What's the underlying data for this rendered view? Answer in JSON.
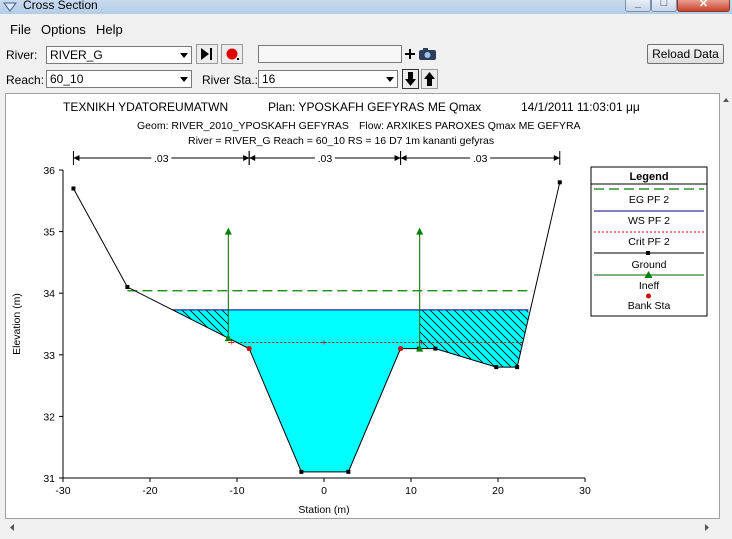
{
  "window": {
    "title": "Cross Section"
  },
  "menu": [
    "File",
    "Options",
    "Help"
  ],
  "toolbar": {
    "river_label": "River:",
    "river_value": "RIVER_G",
    "reach_label": "Reach:",
    "reach_value": "60_10",
    "river_sta_label": "River Sta.:",
    "river_sta_value": "16",
    "search_value": "",
    "reload_label": "Reload Data"
  },
  "plot_header": {
    "line1_left": "TEXNIKH YDATOREUMATWN",
    "line1_plan": "Plan: YPOSKAFH GEFYRAS ME Qmax",
    "line1_date": "14/1/2011   11:03:01 μμ",
    "line2_geom": "Geom: RIVER_2010_YPOSKAFH GEFYRAS",
    "line2_flow": "Flow: ARXIKES PAROXES Qmax ME GEFYRA",
    "line3": "River = RIVER_G   Reach = 60_10      RS = 16    D7 1m kananti gefyras"
  },
  "legend": {
    "title": "Legend",
    "items": [
      "EG PF 2",
      "WS PF 2",
      "Crit PF 2",
      "Ground",
      "Ineff",
      "Bank Sta"
    ]
  },
  "colors": {
    "eg": "#008000",
    "ws": "#000080",
    "crit": "#cc0000",
    "ground": "#000000",
    "ineff": "#006600",
    "bank": "#dd0000",
    "water": "#00ffff"
  },
  "chart_data": {
    "type": "line",
    "xlabel": "Station (m)",
    "ylabel": "Elevation (m)",
    "xlim": [
      -30,
      30
    ],
    "ylim": [
      31,
      36
    ],
    "xticks": [
      -30,
      -20,
      -10,
      0,
      10,
      20,
      30
    ],
    "yticks": [
      31,
      32,
      33,
      34,
      35,
      36
    ],
    "ground": [
      [
        -28.8,
        35.7
      ],
      [
        -22.6,
        34.1
      ],
      [
        -8.6,
        33.1
      ],
      [
        -2.6,
        31.1
      ],
      [
        2.8,
        31.1
      ],
      [
        8.8,
        33.1
      ],
      [
        10.9,
        33.1
      ],
      [
        12.8,
        33.1
      ],
      [
        19.8,
        32.8
      ],
      [
        22.2,
        32.8
      ],
      [
        27.1,
        35.8
      ]
    ],
    "eg_elevation": 34.04,
    "eg_x_range": [
      -22.6,
      24.0
    ],
    "ws_elevation": 33.73,
    "ws_x_range": [
      -17.4,
      23.5
    ],
    "crit_elevation": 33.2,
    "crit_x_range": [
      -11.0,
      23.0
    ],
    "crit_marker_x": [
      -10.6,
      0,
      11.2
    ],
    "bank_stations": [
      [
        -8.6,
        33.1
      ],
      [
        8.8,
        33.1
      ]
    ],
    "ineff": [
      {
        "x": -11.0,
        "elev": 35.0
      },
      {
        "x": 11.0,
        "elev": 35.0
      }
    ],
    "manning": [
      {
        "from": -28.8,
        "to": -8.6,
        "n": ".03"
      },
      {
        "from": -8.6,
        "to": 8.8,
        "n": ".03"
      },
      {
        "from": 8.8,
        "to": 27.1,
        "n": ".03"
      }
    ]
  }
}
